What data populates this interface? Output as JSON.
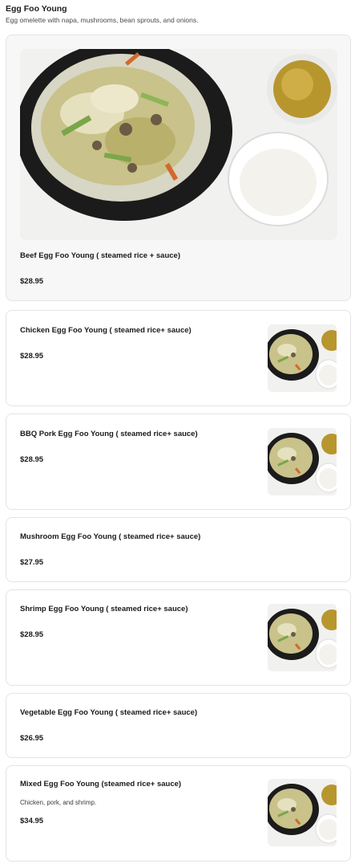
{
  "section": {
    "title": "Egg Foo Young",
    "description": "Egg omelette with napa, mushrooms, bean sprouts, and onions."
  },
  "items": [
    {
      "name": "Beef Egg Foo Young ( steamed rice + sauce)",
      "price": "$28.95",
      "image": "egg-foo-young-photo"
    },
    {
      "name": "Chicken Egg Foo Young ( steamed rice+ sauce)",
      "price": "$28.95",
      "image": "egg-foo-young-photo"
    },
    {
      "name": "BBQ Pork Egg Foo Young ( steamed rice+ sauce)",
      "price": "$28.95",
      "image": "egg-foo-young-photo"
    },
    {
      "name": "Mushroom Egg Foo Young ( steamed rice+ sauce)",
      "price": "$27.95"
    },
    {
      "name": "Shrimp Egg Foo Young ( steamed rice+ sauce)",
      "price": "$28.95",
      "image": "egg-foo-young-photo"
    },
    {
      "name": "Vegetable Egg Foo Young ( steamed rice+ sauce)",
      "price": "$26.95"
    },
    {
      "name": "Mixed Egg Foo Young (steamed rice+ sauce)",
      "description": "Chicken, pork, and shrimp.",
      "price": "$34.95",
      "image": "egg-foo-young-photo"
    }
  ]
}
